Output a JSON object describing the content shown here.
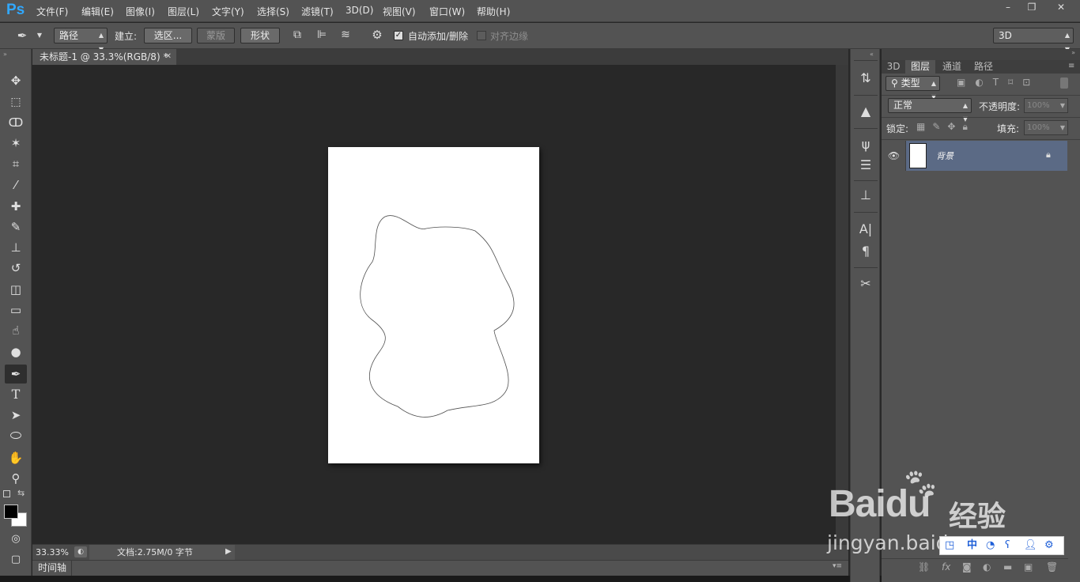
{
  "app": {
    "logo": "Ps"
  },
  "menu": [
    "文件(F)",
    "编辑(E)",
    "图像(I)",
    "图层(L)",
    "文字(Y)",
    "选择(S)",
    "滤镜(T)",
    "3D(D)",
    "视图(V)",
    "窗口(W)",
    "帮助(H)"
  ],
  "window_controls": {
    "minimize": "–",
    "restore": "❐",
    "close": "✕"
  },
  "options": {
    "mode": "路径",
    "make_label": "建立:",
    "selection_btn": "选区...",
    "mask_btn": "蒙版",
    "shape_btn": "形状",
    "auto_add_delete": "自动添加/删除",
    "auto_add_delete_checked": true,
    "align_edges": "对齐边缘",
    "align_edges_checked": false,
    "workspace": "3D"
  },
  "document": {
    "tab_title": "未标题-1 @ 33.3%(RGB/8) *",
    "zoom": "33.33%",
    "doc_info": "文档:2.75M/0 字节",
    "timeline_label": "时间轴"
  },
  "panels": {
    "tabs": [
      "3D",
      "图层",
      "通道",
      "路径"
    ],
    "active_tab": "图层",
    "filter_kind": "类型",
    "blend_mode": "正常",
    "opacity_label": "不透明度:",
    "opacity_value": "100%",
    "lock_label": "锁定:",
    "fill_label": "填充:",
    "fill_value": "100%",
    "layers": [
      {
        "name": "背景",
        "locked": true,
        "visible": true
      }
    ]
  },
  "watermark": {
    "brand": "Baidu",
    "brand_cn": "经验",
    "url": "jingyan.baidu.com",
    "ime_label": "中"
  },
  "colors": {
    "accent": "#31a8ff",
    "selected_layer": "#5b6a85",
    "chrome": "#535353",
    "canvas_bg": "#282828"
  },
  "icons": [
    "pen-tool-icon",
    "move-tool-icon",
    "marquee-tool-icon",
    "lasso-tool-icon",
    "magic-wand-icon",
    "crop-tool-icon",
    "eyedropper-icon",
    "healing-brush-icon",
    "brush-tool-icon",
    "stamp-tool-icon",
    "history-brush-icon",
    "eraser-icon",
    "gradient-icon",
    "smudge-icon",
    "dodge-icon",
    "type-tool-icon",
    "path-select-icon",
    "ellipse-tool-icon",
    "hand-tool-icon",
    "zoom-tool-icon",
    "gear-icon",
    "eye-icon",
    "lock-icon",
    "baidu-paw-icon"
  ]
}
